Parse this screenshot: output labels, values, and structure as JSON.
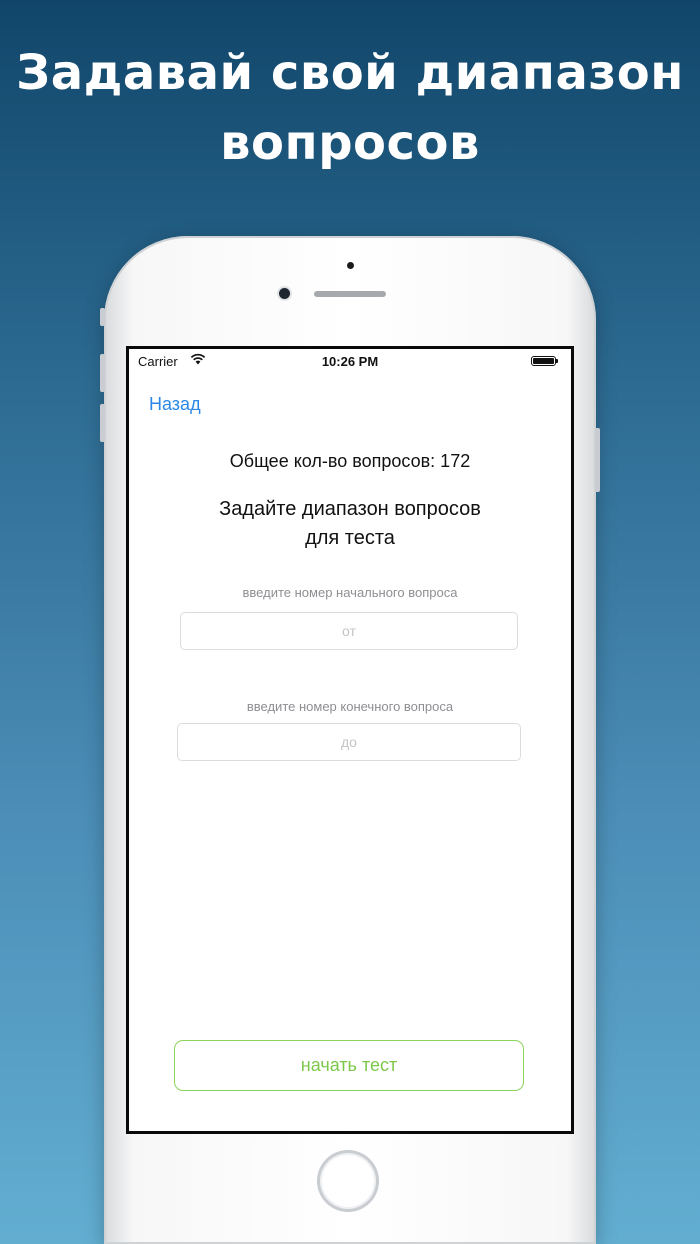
{
  "headline": {
    "line1": "Задавай свой диапазон",
    "line2": "вопросов"
  },
  "status_bar": {
    "carrier": "Carrier",
    "time": "10:26 PM"
  },
  "nav": {
    "back_label": "Назад"
  },
  "content": {
    "total_questions": "Общее кол-во вопросов: 172",
    "subtitle_line1": "Задайте диапазон вопросов",
    "subtitle_line2": "для теста",
    "from_hint": "введите номер начального вопроса",
    "from_placeholder": "от",
    "to_hint": "введите номер конечного вопроса",
    "to_placeholder": "до"
  },
  "actions": {
    "start_label": "начать тест"
  },
  "colors": {
    "link": "#2b88e6",
    "start_button": "#7cc84a",
    "background_top": "#11466a",
    "background_bottom": "#62aed1"
  }
}
